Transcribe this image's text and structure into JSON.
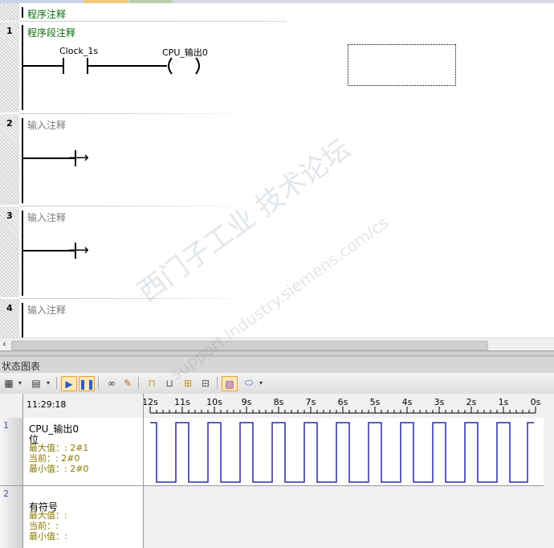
{
  "editor": {
    "program_comment": "程序注释",
    "networks": [
      {
        "number": "1",
        "comment": "程序段注释",
        "contact_label": "Clock_1s",
        "coil_label": "CPU_输出0"
      },
      {
        "number": "2",
        "comment": "输入注释"
      },
      {
        "number": "3",
        "comment": "输入注释"
      },
      {
        "number": "4",
        "comment": "输入注释"
      }
    ]
  },
  "status_chart": {
    "title": "状态图表",
    "time": "11:29:18",
    "axis_ticks": [
      "12s",
      "11s",
      "10s",
      "9s",
      "8s",
      "7s",
      "6s",
      "5s",
      "4s",
      "3s",
      "2s",
      "1s",
      "0s"
    ],
    "rows": [
      {
        "num": "1",
        "name": "CPU_输出0",
        "type": "位",
        "max": "最大值：: 2#1",
        "current": "当前：: 2#0",
        "min": "最小值：: 2#0"
      },
      {
        "num": "2",
        "name": "有符号",
        "max": "最大值：:",
        "current": "当前：:",
        "min": "最小值：:"
      }
    ],
    "colors": {
      "trace": "#2a2aa8",
      "comment_green": "#0a6b0a"
    }
  },
  "chart_data": {
    "type": "line",
    "x_unit": "s (time ago)",
    "xlim": [
      12,
      0
    ],
    "ylim": [
      0,
      1
    ],
    "series": [
      {
        "name": "CPU_输出0",
        "x": [
          12.0,
          11.8,
          11.8,
          11.2,
          11.2,
          10.8,
          10.8,
          10.2,
          10.2,
          9.8,
          9.8,
          9.2,
          9.2,
          8.8,
          8.8,
          8.2,
          8.2,
          7.8,
          7.8,
          7.2,
          7.2,
          6.8,
          6.8,
          6.2,
          6.2,
          5.8,
          5.8,
          5.2,
          5.2,
          4.8,
          4.8,
          4.2,
          4.2,
          3.8,
          3.8,
          3.2,
          3.2,
          2.8,
          2.8,
          2.2,
          2.2,
          1.8,
          1.8,
          1.2,
          1.2,
          0.8,
          0.8,
          0.25,
          0.25,
          0.05
        ],
        "values": [
          1,
          1,
          0,
          0,
          1,
          1,
          0,
          0,
          1,
          1,
          0,
          0,
          1,
          1,
          0,
          0,
          1,
          1,
          0,
          0,
          1,
          1,
          0,
          0,
          1,
          1,
          0,
          0,
          1,
          1,
          0,
          0,
          1,
          1,
          0,
          0,
          1,
          1,
          0,
          0,
          1,
          1,
          0,
          0,
          1,
          1,
          0,
          0,
          1,
          1
        ]
      }
    ]
  }
}
